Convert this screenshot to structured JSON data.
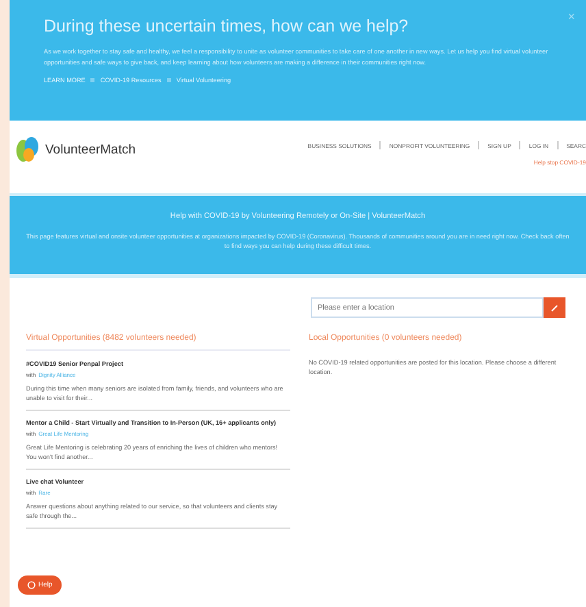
{
  "alert": {
    "title": "During these uncertain times, how can we help?",
    "body": "As we work together to stay safe and healthy, we feel a responsibility to unite as volunteer communities to take care of one another in new ways. Let us help you find virtual volunteer opportunities and safe ways to give back, and keep learning about how volunteers are making a difference in their communities right now.",
    "close": "×",
    "links": [
      "LEARN MORE",
      "COVID-19 Resources",
      "Virtual Volunteering"
    ]
  },
  "header": {
    "logo": "VolunteerMatch",
    "nav": [
      "BUSINESS SOLUTIONS",
      "NONPROFIT VOLUNTEERING",
      "SIGN UP",
      "LOG IN",
      "SEARC"
    ],
    "notice": "Help stop COVID-19"
  },
  "hero": {
    "title": "Help with COVID-19 by Volunteering Remotely or On-Site | VolunteerMatch",
    "text": "This page features virtual and onsite volunteer opportunities at organizations impacted by COVID-19 (Coronavirus). Thousands of communities around you are in need right now. Check back often to find ways you can help during these difficult times."
  },
  "search": {
    "placeholder": "Please enter a location"
  },
  "virtual": {
    "heading": "Virtual Opportunities (8482 volunteers needed)",
    "items": [
      {
        "title": "#COVID19 Senior Penpal Project",
        "org_prefix": "with",
        "org": "Dignity Alliance",
        "text": "During this time when many seniors are isolated from family, friends, and volunteers who are unable to visit for their..."
      },
      {
        "title": "Mentor a Child - Start Virtually and Transition to In-Person (UK, 16+ applicants only)",
        "org_prefix": "with",
        "org": "Great Life Mentoring",
        "text": "Great Life Mentoring is celebrating 20 years of enriching the lives of children who mentors! You won't find another..."
      },
      {
        "title": "Live chat Volunteer",
        "org_prefix": "with",
        "org": "Rare",
        "text": "Answer questions about anything related to our service, so that volunteers and clients stay safe through the..."
      }
    ]
  },
  "local": {
    "heading": "Local Opportunities (0 volunteers needed)",
    "text": "No COVID-19 related opportunities are posted for this location. Please choose a different location."
  },
  "help_button": "Help"
}
